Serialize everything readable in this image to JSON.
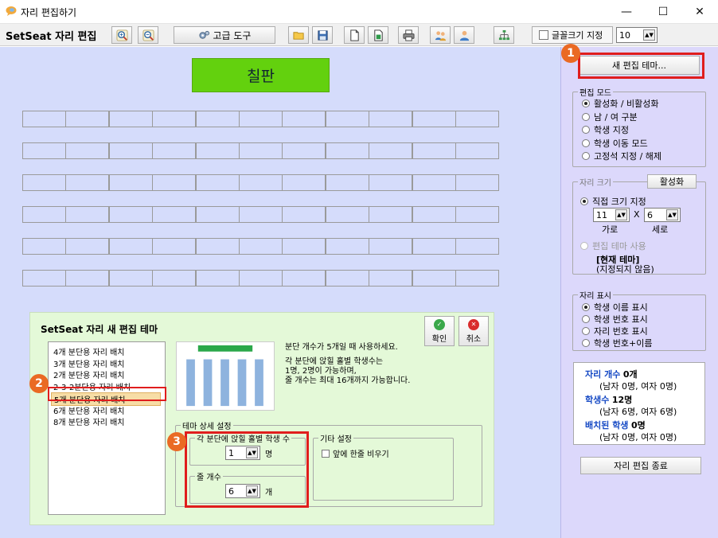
{
  "window": {
    "title": "자리 편집하기",
    "controls": [
      "—",
      "☐",
      "✕"
    ]
  },
  "toolbar": {
    "app_title": "SetSeat 자리 편집",
    "advanced_tools": "고급 도구",
    "font_size_label": "글꼴크기 지정",
    "font_size_value": "10"
  },
  "main": {
    "blackboard": "칠판",
    "seat_rows": 6,
    "seat_cols": 11
  },
  "dialog": {
    "title": "SetSeat 자리 새 편집 테마",
    "ok": "확인",
    "cancel": "취소",
    "themes": [
      "4개 분단용 자리 배치",
      "3개 분단용 자리 배치",
      "2개 분단용 자리 배치",
      "2-3-2분단용 자리 배치",
      "5개 분단용 자리 배치",
      "6개 분단용 자리 배치",
      "8개 분단용 자리 배치"
    ],
    "selected_index": 4,
    "description": [
      "분단 개수가 5개일 때 사용하세요.",
      "",
      "각 분단에 앉힐 홀별 학생수는",
      "1명, 2명이 가능하며,",
      "줄 개수는 최대 16개까지 가능합니다."
    ],
    "detail_group": "테마 상세 설정",
    "students_group": "각 분단에 앉힐 홀별 학생 수",
    "students_value": "1",
    "students_unit": "명",
    "rows_group": "줄 개수",
    "rows_value": "6",
    "rows_unit": "개",
    "other_group": "기타 설정",
    "empty_front_label": "앞에 한줄 비우기"
  },
  "side": {
    "new_theme_button": "새 편집 테마...",
    "edit_mode": {
      "legend": "편집 모드",
      "options": [
        "활성화 / 비활성화",
        "남 / 여 구분",
        "학생 지정",
        "학생 이동 모드",
        "고정석 지정 / 해제"
      ],
      "selected": 0
    },
    "seat_size": {
      "legend": "자리 크기",
      "activate_button": "활성화",
      "direct_label": "직접 크기 지정",
      "width_value": "11",
      "times": "X",
      "height_value": "6",
      "width_label": "가로",
      "height_label": "세로",
      "theme_label": "편집 테마 사용",
      "current_theme_title": "[현재 테마]",
      "current_theme_value": "(지정되지 않음)"
    },
    "seat_display": {
      "legend": "자리 표시",
      "options": [
        "학생 이름 표시",
        "학생 번호 표시",
        "자리 번호 표시",
        "학생 번호+이름"
      ],
      "selected": 0
    },
    "stats": {
      "seat_count_label": "자리 개수",
      "seat_count_value": "0개",
      "seat_count_detail": "(남자 0명, 여자 0명)",
      "students_label": "학생수",
      "students_value": "12명",
      "students_detail": "(남자 6명, 여자 6명)",
      "placed_label": "배치된 학생",
      "placed_value": "0명",
      "placed_detail": "(남자 0명, 여자 0명)"
    },
    "end_button": "자리 편집 종료"
  },
  "badges": [
    "1",
    "2",
    "3"
  ],
  "colors": {
    "blackboard": "#63d10e",
    "main_bg": "#d5dcfb",
    "side_bg": "#dcd8fb",
    "dialog_bg": "#e4f9d8",
    "highlight": "#e01d1d",
    "badge": "#ea6a24",
    "stat_label": "#1448c4"
  },
  "icons": [
    "app-chat-icon",
    "zoom-in-icon",
    "zoom-out-icon",
    "gear-icon",
    "folder-open-icon",
    "save-icon",
    "new-page-icon",
    "excel-icon",
    "print-icon",
    "users-icon",
    "user-icon",
    "hierarchy-icon",
    "check-icon",
    "cancel-icon"
  ]
}
